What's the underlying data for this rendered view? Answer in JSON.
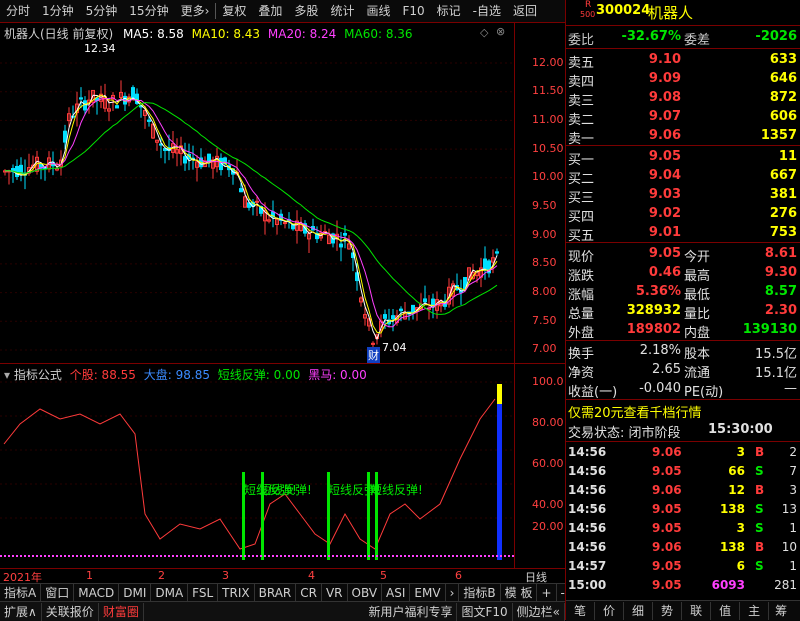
{
  "toolbar": {
    "items": [
      "分时",
      "1分钟",
      "5分钟",
      "15分钟",
      "更多›",
      "复权",
      "叠加",
      "多股",
      "统计",
      "画线",
      "F10",
      "标记",
      "-自选",
      "返回"
    ]
  },
  "chart_header": {
    "title": "机器人(日线 前复权)",
    "ma5": "MA5: 8.58",
    "ma10": "MA10: 8.43",
    "ma20": "MA20: 8.24",
    "ma60": "MA60: 8.36",
    "high_label": "12.34",
    "low_label": "7.04",
    "cai_badge": "财"
  },
  "indicator_header": {
    "title": "指标公式",
    "gegu": "个股: 88.55",
    "dapan": "大盘: 98.85",
    "duanxian": "短线反弹: 0.00",
    "heima": "黑马: 0.00"
  },
  "indicator_annotations": [
    "短线反弹!",
    "短线反弹!",
    "短线反弹!",
    "短线反弹!"
  ],
  "price_axis": [
    "12.00",
    "11.50",
    "11.00",
    "10.50",
    "10.00",
    "9.50",
    "9.00",
    "8.50",
    "8.00",
    "7.50",
    "7.00"
  ],
  "ind_axis": [
    "100.0",
    "80.00",
    "60.00",
    "40.00",
    "20.00"
  ],
  "time_axis": {
    "year": "2021年",
    "months": [
      "1",
      "2",
      "3",
      "4",
      "5",
      "6"
    ],
    "period": "日线"
  },
  "tabs_bottom": [
    "指标A",
    "窗口",
    "MACD",
    "DMI",
    "DMA",
    "FSL",
    "TRIX",
    "BRAR",
    "CR",
    "VR",
    "OBV",
    "ASI",
    "EMV",
    "›",
    "指标B",
    "模 板",
    "+",
    "-"
  ],
  "status_bar": {
    "left": [
      "扩展∧",
      "关联报价",
      "财富圈"
    ],
    "right": [
      "新用户福利专享",
      "图文F10",
      "侧边栏«"
    ]
  },
  "quote": {
    "r_badge": "R",
    "r_num": "500",
    "code": "300024",
    "name": "机器人",
    "weibi_label": "委比",
    "weibi": "-32.67%",
    "weicha_label": "委差",
    "weicha": "-2026",
    "asks": [
      {
        "label": "卖五",
        "price": "9.10",
        "vol": "633"
      },
      {
        "label": "卖四",
        "price": "9.09",
        "vol": "646"
      },
      {
        "label": "卖三",
        "price": "9.08",
        "vol": "872"
      },
      {
        "label": "卖二",
        "price": "9.07",
        "vol": "606"
      },
      {
        "label": "卖一",
        "price": "9.06",
        "vol": "1357"
      }
    ],
    "bids": [
      {
        "label": "买一",
        "price": "9.05",
        "vol": "11"
      },
      {
        "label": "买二",
        "price": "9.04",
        "vol": "667"
      },
      {
        "label": "买三",
        "price": "9.03",
        "vol": "381"
      },
      {
        "label": "买四",
        "price": "9.02",
        "vol": "276"
      },
      {
        "label": "买五",
        "price": "9.01",
        "vol": "753"
      }
    ],
    "stats": [
      {
        "l1": "现价",
        "v1": "9.05",
        "c1": "red",
        "l2": "今开",
        "v2": "8.61",
        "c2": "red"
      },
      {
        "l1": "涨跌",
        "v1": "0.46",
        "c1": "red",
        "l2": "最高",
        "v2": "9.30",
        "c2": "red"
      },
      {
        "l1": "涨幅",
        "v1": "5.36%",
        "c1": "red",
        "l2": "最低",
        "v2": "8.57",
        "c2": "green"
      },
      {
        "l1": "总量",
        "v1": "328932",
        "c1": "yellow",
        "l2": "量比",
        "v2": "2.30",
        "c2": "red"
      },
      {
        "l1": "外盘",
        "v1": "189802",
        "c1": "red",
        "l2": "内盘",
        "v2": "139130",
        "c2": "green"
      }
    ],
    "stats2": [
      {
        "l1": "换手",
        "v1": "2.18%",
        "l2": "股本",
        "v2": "15.5亿"
      },
      {
        "l1": "净资",
        "v1": "2.65",
        "l2": "流通",
        "v2": "15.1亿"
      },
      {
        "l1": "收益(一)",
        "v1": "-0.040",
        "l2": "PE(动)",
        "v2": "—"
      }
    ],
    "promo": "仅需20元查看千档行情",
    "trade_status_label": "交易状态: 闭市阶段",
    "trade_status_time": "15:30:00",
    "ticks": [
      {
        "t": "14:56",
        "p": "9.06",
        "v": "3",
        "s": "B",
        "n": "2"
      },
      {
        "t": "14:56",
        "p": "9.05",
        "v": "66",
        "s": "S",
        "n": "7"
      },
      {
        "t": "14:56",
        "p": "9.06",
        "v": "12",
        "s": "B",
        "n": "3"
      },
      {
        "t": "14:56",
        "p": "9.05",
        "v": "138",
        "s": "S",
        "n": "13"
      },
      {
        "t": "14:56",
        "p": "9.05",
        "v": "3",
        "s": "S",
        "n": "1"
      },
      {
        "t": "14:56",
        "p": "9.06",
        "v": "138",
        "s": "B",
        "n": "10"
      },
      {
        "t": "14:57",
        "p": "9.05",
        "v": "6",
        "s": "S",
        "n": "1"
      },
      {
        "t": "15:00",
        "p": "9.05",
        "v": "6093",
        "s": "",
        "n": "281"
      }
    ],
    "side_tabs": [
      "笔",
      "价",
      "细",
      "势",
      "联",
      "值",
      "主",
      "筹"
    ]
  },
  "colors": {
    "up": "#ff3b3b",
    "down": "#00e600",
    "grid": "#7a0000",
    "ma5": "#ffffff",
    "ma10": "#ffff00",
    "ma20": "#ff40ff",
    "ma60": "#00e600"
  }
}
